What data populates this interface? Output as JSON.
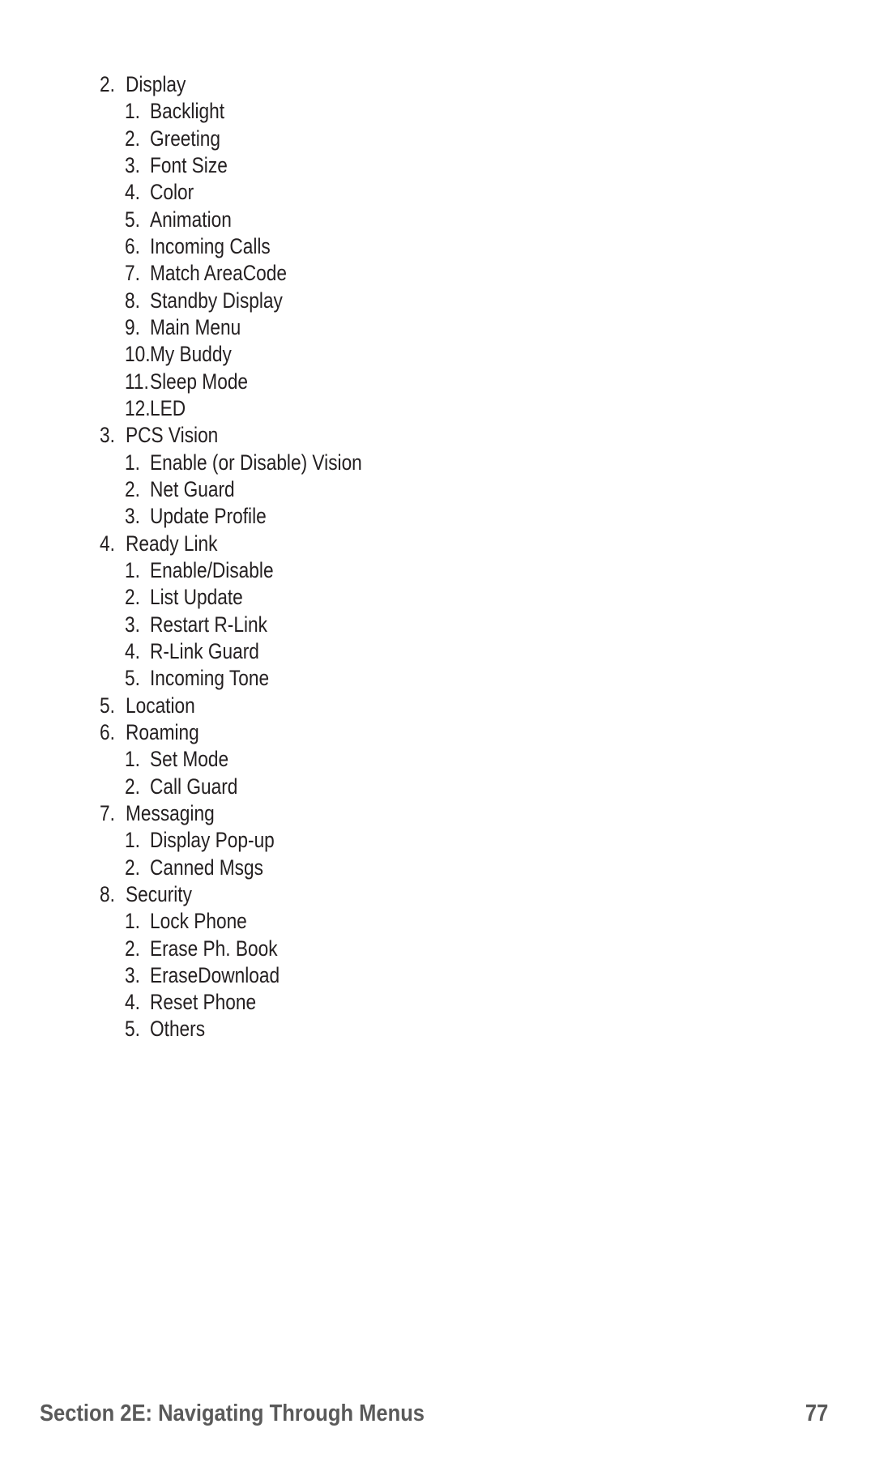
{
  "menu": [
    {
      "num": "2.",
      "label": "Display",
      "children": [
        {
          "num": "1.",
          "label": "Backlight"
        },
        {
          "num": "2.",
          "label": "Greeting"
        },
        {
          "num": "3.",
          "label": "Font Size"
        },
        {
          "num": "4.",
          "label": "Color"
        },
        {
          "num": "5.",
          "label": "Animation"
        },
        {
          "num": "6.",
          "label": "Incoming Calls"
        },
        {
          "num": "7.",
          "label": "Match AreaCode"
        },
        {
          "num": "8.",
          "label": "Standby Display"
        },
        {
          "num": "9.",
          "label": "Main Menu"
        },
        {
          "num": "10.",
          "label": "My Buddy"
        },
        {
          "num": "11.",
          "label": "Sleep Mode"
        },
        {
          "num": "12.",
          "label": "LED"
        }
      ]
    },
    {
      "num": "3.",
      "label": "PCS Vision",
      "children": [
        {
          "num": "1.",
          "label": "Enable (or Disable) Vision"
        },
        {
          "num": "2.",
          "label": "Net Guard"
        },
        {
          "num": "3.",
          "label": "Update Profile"
        }
      ]
    },
    {
      "num": "4.",
      "label": "Ready Link",
      "children": [
        {
          "num": "1.",
          "label": "Enable/Disable"
        },
        {
          "num": "2.",
          "label": "List Update"
        },
        {
          "num": "3.",
          "label": "Restart R-Link"
        },
        {
          "num": "4.",
          "label": "R-Link Guard"
        },
        {
          "num": "5.",
          "label": "Incoming Tone"
        }
      ]
    },
    {
      "num": "5.",
      "label": "Location",
      "children": []
    },
    {
      "num": "6.",
      "label": "Roaming",
      "children": [
        {
          "num": "1.",
          "label": "Set Mode"
        },
        {
          "num": "2.",
          "label": "Call Guard"
        }
      ]
    },
    {
      "num": "7.",
      "label": "Messaging",
      "children": [
        {
          "num": "1.",
          "label": "Display Pop-up"
        },
        {
          "num": "2.",
          "label": "Canned Msgs"
        }
      ]
    },
    {
      "num": "8.",
      "label": "Security",
      "children": [
        {
          "num": "1.",
          "label": "Lock Phone"
        },
        {
          "num": "2.",
          "label": "Erase Ph. Book"
        },
        {
          "num": "3.",
          "label": "EraseDownload"
        },
        {
          "num": "4.",
          "label": "Reset Phone"
        },
        {
          "num": "5.",
          "label": "Others"
        }
      ]
    }
  ],
  "footer": {
    "section_title": "Section 2E: Navigating Through Menus",
    "page_number": "77"
  }
}
